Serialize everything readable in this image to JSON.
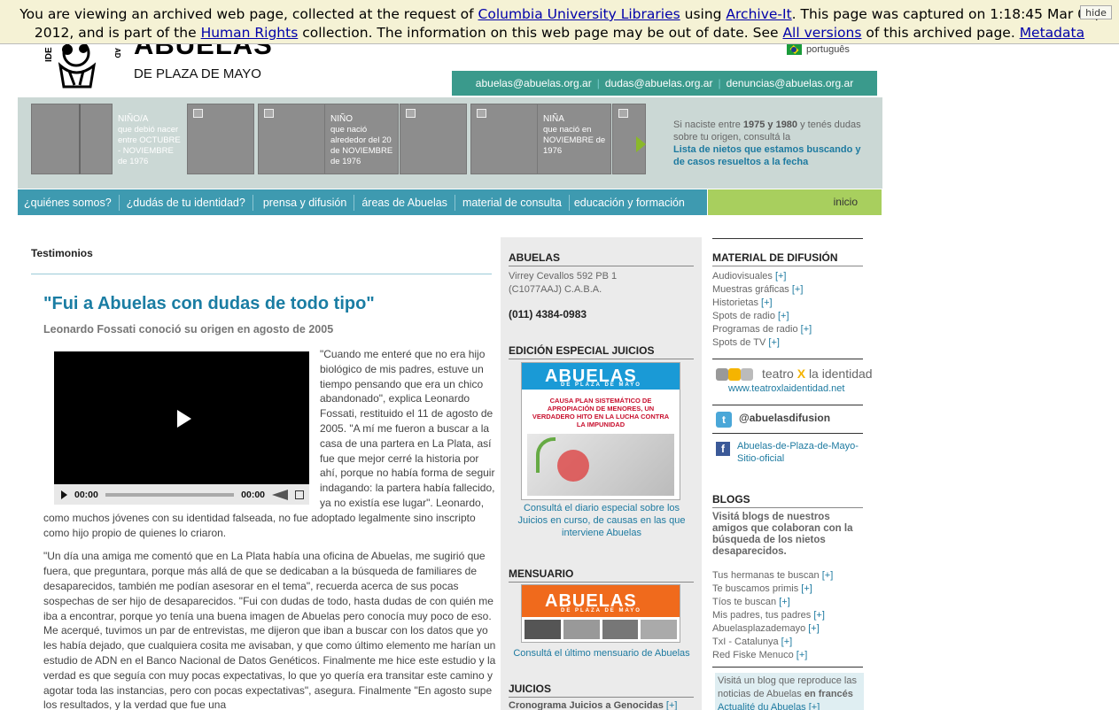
{
  "archive_banner": {
    "text_1": "You are viewing an archived web page, collected at the request of ",
    "link_columbia": "Columbia University Libraries",
    "text_2": " using ",
    "link_archive_it": "Archive-It",
    "text_3": ". This page was captured on 1:18:45 Mar 03, 2012, and is part of the ",
    "link_human_rights": "Human Rights",
    "text_4": " collection. The information on this web page may be out of date. See ",
    "link_all_versions": "All versions",
    "text_5": " of this archived page. ",
    "link_metadata": "Metadata",
    "hide": "hide"
  },
  "header": {
    "logo_big": "ABUELAS",
    "logo_small": "DE PLAZA DE MAYO",
    "logo_side_letters": "IDE",
    "logo_side_letters_right": "AD",
    "language": "português",
    "emails": [
      "abuelas@abuelas.org.ar",
      "dudas@abuelas.org.ar",
      "denuncias@abuelas.org.ar"
    ]
  },
  "carousel": {
    "tiles": [
      {
        "t1": "NIÑO/A",
        "t2": "que debió nacer entre OCTUBRE - NOVIEMBRE de 1976"
      },
      {
        "t1": "NIÑO",
        "t2": "que nació alrededor del 20 de NOVIEMBRE de 1976"
      },
      {
        "t1": "NIÑA",
        "t2": "que nació en NOVIEMBRE de 1976"
      }
    ],
    "info_1": "Si naciste entre ",
    "info_years_a": "1975 y 1980",
    "info_2": " y tenés dudas sobre tu origen, consultá la",
    "info_link": "Lista de nietos que estamos buscando y de casos resueltos a la fecha"
  },
  "nav": {
    "items": [
      "¿quiénes somos?",
      "¿dudás de tu identidad?",
      "prensa y difusión",
      "áreas de Abuelas",
      "material de consulta",
      "educación y formación"
    ],
    "home": "inicio"
  },
  "article": {
    "breadcrumb": "Testimonios",
    "title": "\"Fui a Abuelas con dudas de todo tipo\"",
    "subtitle": "Leonardo Fossati conoció su origen en agosto de 2005",
    "video_time_current": "00:00",
    "video_time_total": "00:00",
    "p1": "\"Cuando me enteré que no era hijo biológico de mis padres, estuve un tiempo pensando que era un chico abandonado\", explica Leonardo Fossati, restituido el 11 de agosto de 2005. \"A mí me fueron a buscar a la casa de una partera en La Plata, así fue que mejor cerré la historia por ahí, porque no había forma de seguir indagando: la partera había fallecido, ya no existía ese lugar\". Leonardo, como muchos jóvenes con su identidad falseada, no fue adoptado legalmente sino inscripto como hijo propio de quienes lo criaron.",
    "p2": "\"Un día una amiga me comentó que en La Plata había una oficina de Abuelas, me sugirió que fuera, que preguntara, porque más allá de que se dedicaban a la búsqueda de familiares de desaparecidos, también me podían asesorar en el tema\", recuerda acerca de sus pocas sospechas de ser hijo de desaparecidos. \"Fui con dudas de todo, hasta dudas de con quién me iba a encontrar, porque yo tenía una buena imagen de Abuelas pero conocía muy poco de eso. Me acerqué, tuvimos un par de entrevistas, me dijeron que iban a buscar con los datos que yo les había dejado, que cualquiera cosita me avisaban, y que como último elemento me harían un estudio de ADN en el Banco Nacional de Datos Genéticos. Finalmente me hice este estudio y la verdad es que seguía con muy pocas expectativas, lo que yo quería era transitar este camino y agotar toda las instancias, pero con pocas expectativas\", asegura. Finalmente \"En agosto supe los resultados, y la verdad que fue una"
  },
  "col2": {
    "abuelas_title": "ABUELAS",
    "address_1": "Virrey Cevallos 592 PB 1",
    "address_2": "(C1077AAJ) C.A.B.A.",
    "phone": "(011) 4384-0983",
    "special_title": "EDICIÓN ESPECIAL JUICIOS",
    "paper_name": "ABUELAS",
    "paper_sub": "DE PLAZA DE MAYO",
    "special_headline": "CAUSA PLAN SISTEMÁTICO DE APROPIACIÓN DE MENORES, UN VERDADERO HITO EN LA LUCHA CONTRA LA IMPUNIDAD",
    "special_caption": "Consultá el diario especial sobre los Juicios en curso, de causas en las que interviene Abuelas",
    "monthly_title": "MENSUARIO",
    "monthly_caption": "Consultá el último mensuario de Abuelas",
    "juicios_title": "JUICIOS",
    "juicios_link": "Cronograma Juicios a Genocidas",
    "plus": "[+]"
  },
  "col3": {
    "material_title": "MATERIAL DE DIFUSIÓN",
    "material_items": [
      "Audiovisuales",
      "Muestras gráficas",
      "Historietas",
      "Spots de radio",
      "Programas de radio",
      "Spots de TV"
    ],
    "teatro_1": "teatro",
    "teatro_x": "X",
    "teatro_2": "la identidad",
    "teatro_url": "www.teatroxlaidentidad.net",
    "twitter": "@abuelasdifusion",
    "facebook": "Abuelas-de-Plaza-de-Mayo-Sitio-oficial",
    "blogs_title": "BLOGS",
    "blogs_intro": "Visitá blogs de nuestros amigos que colaboran con la búsqueda de los nietos desaparecidos.",
    "blog_items": [
      "Tus hermanas te buscan",
      "Te buscamos primis",
      "Tíos te buscan",
      "Mis padres, tus padres",
      "Abuelasplazademayo",
      "TxI - Catalunya",
      "Red Fiske Menuco"
    ],
    "french_1": "Visitá un blog que reproduce las noticias de Abuelas ",
    "french_bold": "en francés",
    "french_link": "Actualité du Abuelas",
    "plus": "[+]"
  },
  "colors": {
    "teal": "#3a9a8c",
    "nav_blue": "#3e9ab0",
    "green": "#a8cf5e",
    "title_blue": "#1a7da3"
  }
}
